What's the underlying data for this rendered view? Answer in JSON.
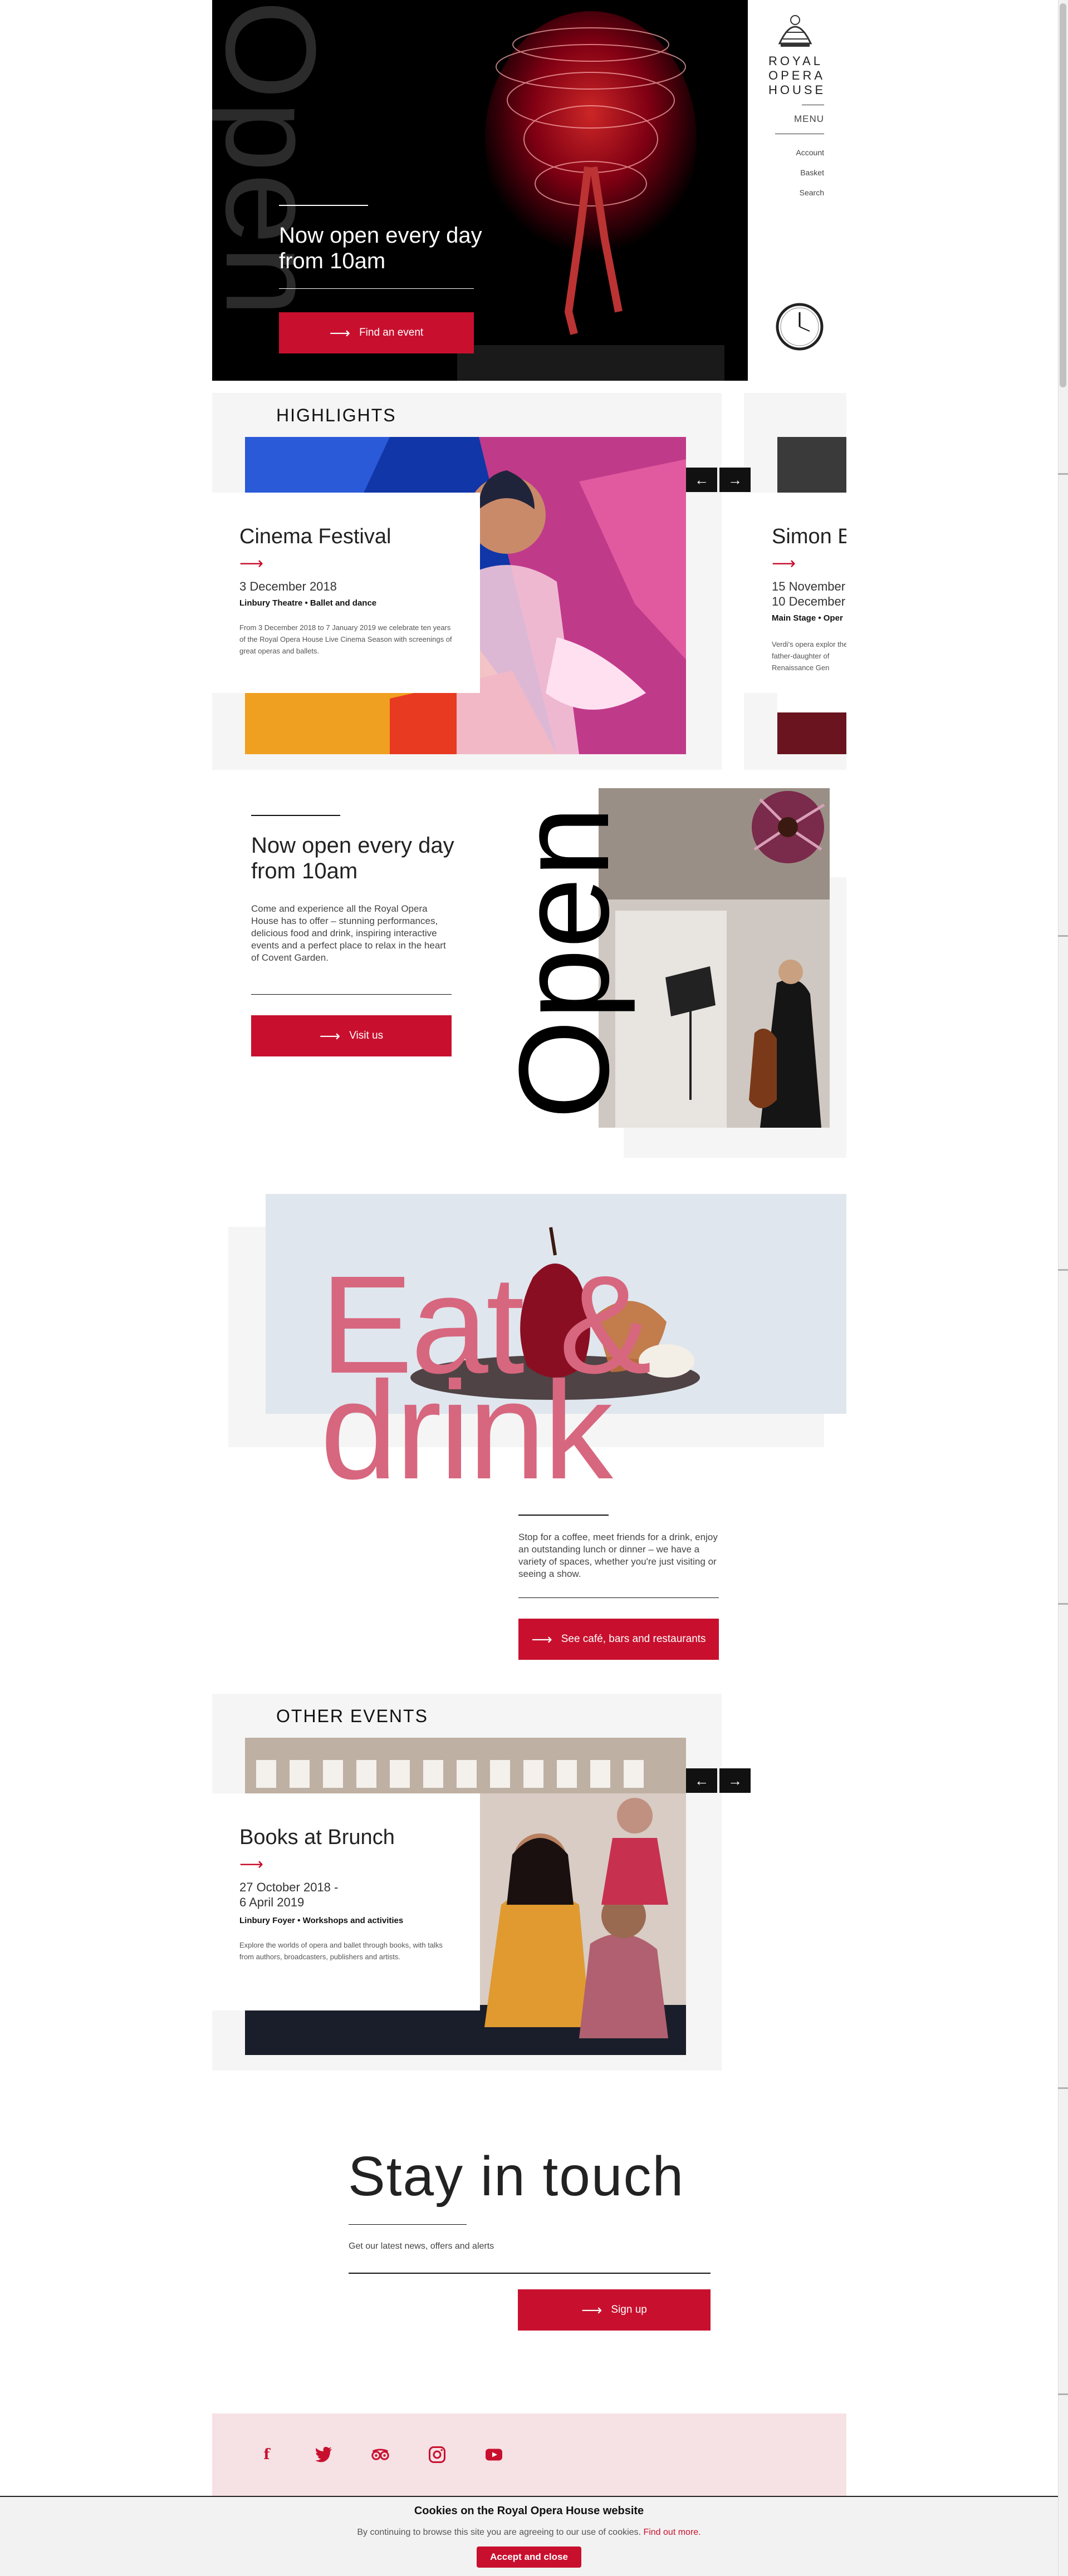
{
  "hero": {
    "big_word": "Open",
    "title": "Now open every day from 10am",
    "button": "Find an event"
  },
  "logo": {
    "line1": "ROYAL",
    "line2": "OPERA",
    "line3": "HOUSE"
  },
  "nav": {
    "menu": "MENU",
    "links": [
      "Account",
      "Basket",
      "Search"
    ]
  },
  "highlights": {
    "title": "HIGHLIGHTS",
    "cards": [
      {
        "title": "Cinema Festival",
        "date": "3 December 2018",
        "venue": "Linbury Theatre  •  Ballet and dance",
        "description": "From 3 December 2018 to 7 January 2019 we celebrate ten years of the Royal Opera House Live Cinema Season with screenings of great operas and ballets."
      },
      {
        "title": "Simon B",
        "date_line1": "15 November",
        "date_line2": "10 December",
        "venue": "Main Stage  •  Oper",
        "description": "Verdi's opera explor the father-daughter of Renaissance Gen"
      }
    ]
  },
  "open_section": {
    "title": "Now open every day from 10am",
    "body": "Come and experience all the Royal Opera House has to offer – stunning performances, delicious food and drink, inspiring interactive events and a perfect place to relax in the heart of Covent Garden.",
    "button": "Visit us",
    "big_word": "Open"
  },
  "eat": {
    "line1": "Eat &",
    "line2": "drink",
    "body": "Stop for a coffee, meet friends for a drink, enjoy an outstanding lunch or dinner – we have a variety of spaces, whether you're just visiting or seeing a show.",
    "button": "See café, bars and restaurants"
  },
  "other_events": {
    "title": "OTHER EVENTS",
    "card": {
      "title": "Books at Brunch",
      "date_line1": "27 October 2018 -",
      "date_line2": "6 April 2019",
      "venue": "Linbury Foyer  •  Workshops and activities",
      "description": "Explore the worlds of opera and ballet through books, with talks from authors, broadcasters, publishers and artists."
    }
  },
  "stay": {
    "title": "Stay in touch",
    "subtitle": "Get our latest news, offers and alerts",
    "button": "Sign up"
  },
  "social": [
    "facebook-icon",
    "twitter-icon",
    "tripadvisor-icon",
    "instagram-icon",
    "youtube-icon"
  ],
  "cookie": {
    "title": "Cookies on the Royal Opera House website",
    "text": "By continuing to browse this site you are agreeing to our use of cookies.",
    "link": "Find out more.",
    "button": "Accept and close"
  },
  "colors": {
    "accent": "#c8102e",
    "pink": "#d7677e",
    "panel": "#f5f5f5"
  }
}
